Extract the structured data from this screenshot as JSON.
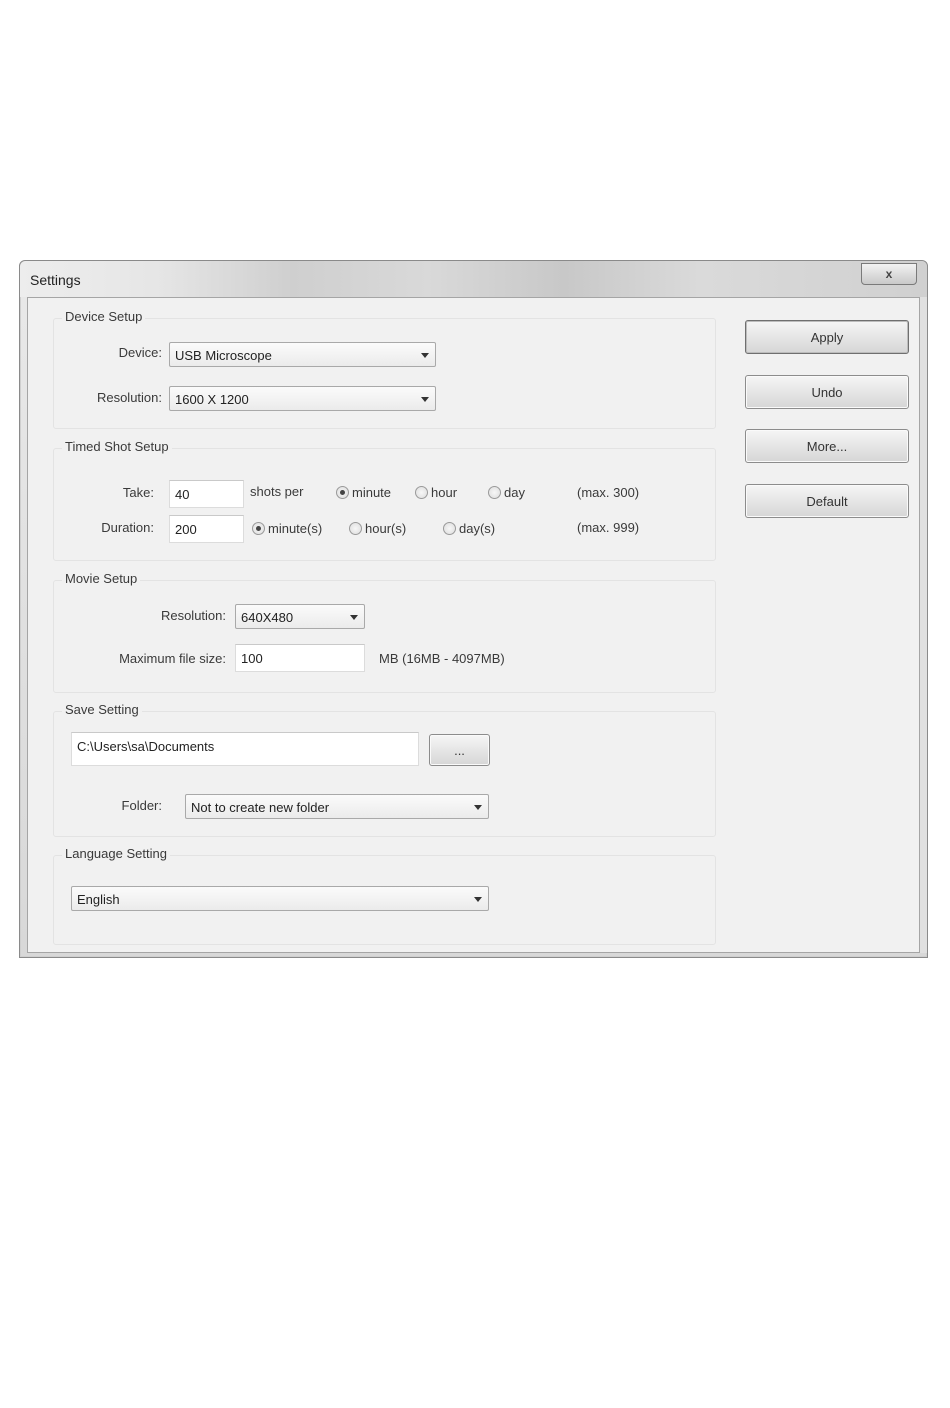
{
  "window": {
    "title": "Settings",
    "close_label": "x"
  },
  "device_setup": {
    "label": "Device Setup",
    "device_label": "Device:",
    "device_value": "USB Microscope",
    "resolution_label": "Resolution:",
    "resolution_value": "1600 X 1200"
  },
  "timed_shot": {
    "label": "Timed Shot Setup",
    "take_label": "Take:",
    "take_value": "40",
    "shots_per_label": "shots per",
    "per_options": [
      {
        "label": "minute",
        "selected": true
      },
      {
        "label": "hour",
        "selected": false
      },
      {
        "label": "day",
        "selected": false
      }
    ],
    "take_max": "(max. 300)",
    "duration_label": "Duration:",
    "duration_value": "200",
    "duration_options": [
      {
        "label": "minute(s)",
        "selected": true
      },
      {
        "label": "hour(s)",
        "selected": false
      },
      {
        "label": "day(s)",
        "selected": false
      }
    ],
    "duration_max": "(max. 999)"
  },
  "movie_setup": {
    "label": "Movie Setup",
    "resolution_label": "Resolution:",
    "resolution_value": "640X480",
    "max_size_label": "Maximum file size:",
    "max_size_value": "100",
    "max_size_hint": "MB (16MB - 4097MB)"
  },
  "save_setting": {
    "label": "Save Setting",
    "path_value": "C:\\Users\\sa\\Documents",
    "browse_label": "...",
    "folder_label": "Folder:",
    "folder_value": "Not to create new folder"
  },
  "language_setting": {
    "label": "Language Setting",
    "value": "English"
  },
  "buttons": {
    "apply": "Apply",
    "undo": "Undo",
    "more": "More...",
    "default": "Default"
  }
}
